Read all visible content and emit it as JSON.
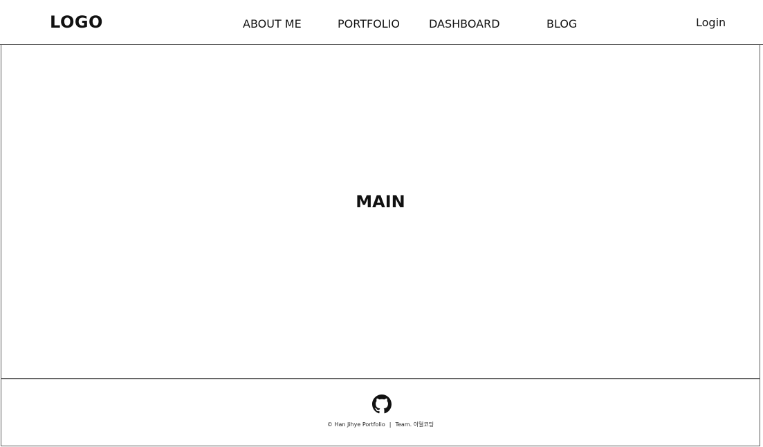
{
  "header": {
    "logo": "LOGO",
    "nav": [
      {
        "label": "ABOUT ME"
      },
      {
        "label": "PORTFOLIO"
      },
      {
        "label": "DASHBOARD"
      },
      {
        "label": "BLOG"
      }
    ],
    "login_label": "Login"
  },
  "main": {
    "label": "MAIN"
  },
  "footer": {
    "icon": "github-icon",
    "copyright": "© Han Jihye Portfolio",
    "separator": "|",
    "team": "Team. 이멀코딩"
  },
  "colors": {
    "border": "#555555",
    "text": "#111111",
    "background": "#ffffff"
  }
}
